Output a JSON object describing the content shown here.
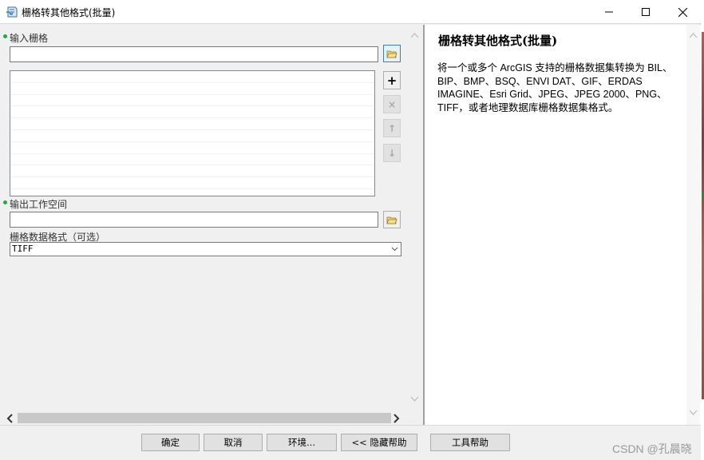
{
  "window": {
    "title": "栅格转其他格式(批量)",
    "icon": "toolbox-script-icon"
  },
  "params": {
    "input_label": "输入栅格",
    "input_value": "",
    "output_label": "输出工作空间",
    "output_value": "",
    "format_label": "栅格数据格式（可选）",
    "format_value": "TIFF"
  },
  "list_buttons": {
    "add": "+",
    "remove": "×",
    "up": "↑",
    "down": "↓"
  },
  "help": {
    "title": "栅格转其他格式(批量)",
    "body": "将一个或多个 ArcGIS 支持的栅格数据集转换为 BIL、BIP、BMP、BSQ、ENVI DAT、GIF、ERDAS IMAGINE、Esri Grid、JPEG、JPEG 2000、PNG、TIFF，或者地理数据库栅格数据集格式。"
  },
  "buttons": {
    "ok": "确定",
    "cancel": "取消",
    "env": "环境...",
    "hide_help": "<< 隐藏帮助",
    "tool_help": "工具帮助"
  },
  "watermark": "CSDN @孔晨晓",
  "colors": {
    "required_dot": "#19b13d",
    "panel_bg": "#f0f0f0"
  }
}
